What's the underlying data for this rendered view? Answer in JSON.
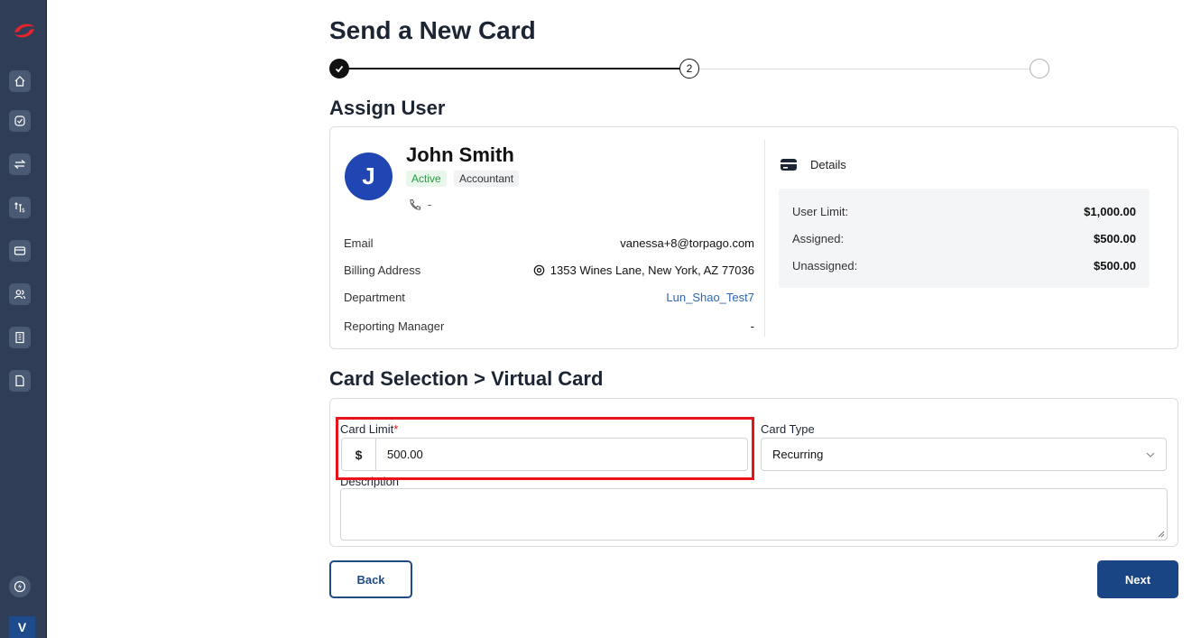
{
  "page_title": "Send a New Card",
  "stepper": {
    "current_step": "2"
  },
  "assign_user": {
    "section_title": "Assign User",
    "avatar_initial": "J",
    "name": "John Smith",
    "status_badge": "Active",
    "role_badge": "Accountant",
    "phone": "-",
    "fields": [
      {
        "label": "Email",
        "value": "vanessa+8@torpago.com"
      },
      {
        "label": "Billing Address",
        "value": "1353 Wines Lane, New York, AZ 77036"
      },
      {
        "label": "Department",
        "value": "Lun_Shao_Test7"
      },
      {
        "label": "Reporting Manager",
        "value": "-"
      }
    ],
    "details": {
      "title": "Details",
      "rows": [
        {
          "label": "User Limit:",
          "value": "$1,000.00"
        },
        {
          "label": "Assigned:",
          "value": "$500.00"
        },
        {
          "label": "Unassigned:",
          "value": "$500.00"
        }
      ]
    }
  },
  "card_selection": {
    "section_title": "Card Selection > Virtual Card",
    "card_limit_label": "Card Limit",
    "required_mark": "*",
    "currency_symbol": "$",
    "card_limit_value": "500.00",
    "card_type_label": "Card Type",
    "card_type_value": "Recurring",
    "description_label": "Description"
  },
  "buttons": {
    "back": "Back",
    "next": "Next"
  },
  "sidebar": {
    "user_initial": "V",
    "icons": [
      "home-icon",
      "check-circle-icon",
      "transfer-icon",
      "reimburse-icon",
      "card-icon",
      "users-icon",
      "building-icon",
      "document-icon",
      "lightning-icon"
    ]
  },
  "colors": {
    "primary": "#1a4585",
    "highlight": "#e8141b",
    "active_green": "#1f9d3a",
    "sidebar": "#2f3e56"
  }
}
